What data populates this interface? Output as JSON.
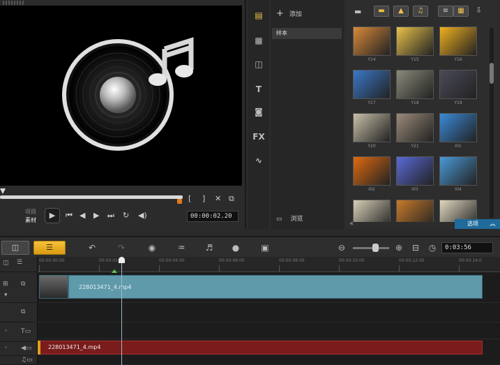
{
  "preview": {
    "mode_project": "项目",
    "mode_clip": "素材",
    "timecode": "00:00:02.20",
    "mark_in": "[",
    "mark_out": "]"
  },
  "library": {
    "add_label": "添加",
    "folder_sample": "样本",
    "browse_label": "浏览",
    "options_label": "选项",
    "thumbnails": [
      {
        "label": "Y14",
        "color": "#d98a3a"
      },
      {
        "label": "Y15",
        "color": "#e8c24a"
      },
      {
        "label": "Y16",
        "color": "#f0b020"
      },
      {
        "label": "Y17",
        "color": "#3a78c8"
      },
      {
        "label": "Y18",
        "color": "#8a8a7a"
      },
      {
        "label": "Y19",
        "color": "#4a4a58"
      },
      {
        "label": "Y20",
        "color": "#c8c0a8"
      },
      {
        "label": "Y21",
        "color": "#9a8a7a"
      },
      {
        "label": "I01",
        "color": "#3a8ad8"
      },
      {
        "label": "I02",
        "color": "#e06a10"
      },
      {
        "label": "I03",
        "color": "#5a6ad8"
      },
      {
        "label": "I04",
        "color": "#4a9ad8"
      },
      {
        "label": "",
        "color": "#d8d0b8"
      },
      {
        "label": "",
        "color": "#c87a2a"
      },
      {
        "label": "",
        "color": "#e0d8c0"
      }
    ]
  },
  "timeline": {
    "duration": "0:03:56",
    "duration_suffix": "∏",
    "ruler_ticks": [
      "00:00:00:00",
      "00:00:02:00",
      "00:00:04:00",
      "00:00:06:00",
      "00:00:08:00",
      "00:00:10:00",
      "00:00:12:00",
      "00:00:14:0"
    ],
    "video_clip_name": "228013471_4.mp4",
    "audio_clip_name": "228013471_4.mp4"
  },
  "colors": {
    "accent_yellow": "#f6c23a",
    "video_clip": "#5f9aaa",
    "audio_clip": "#7a1c1c",
    "options_blue": "#1f6b9b"
  }
}
